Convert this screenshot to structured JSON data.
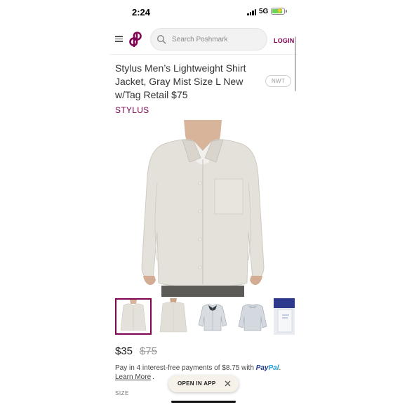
{
  "status_bar": {
    "time": "2:24",
    "network": "5G",
    "battery_level": 0.8,
    "battery_color": "#6cd454"
  },
  "header": {
    "menu_icon": "hamburger-menu-icon",
    "logo_icon": "poshmark-logo-icon",
    "search_placeholder": "Search Poshmark",
    "login_label": "LOGIN",
    "accent_color": "#7f0353"
  },
  "listing": {
    "title": "Stylus Men’s Lightweight Shirt Jacket, Gray Mist Size L New w/Tag Retail $75",
    "condition_badge": "NWT",
    "brand": "STYLUS",
    "price": "$35",
    "original_price": "$75",
    "pay_text": "Pay in 4 interest-free payments of $8.75 with",
    "paypal_part1": "Pay",
    "paypal_part2": "Pal",
    "pay_end": ".",
    "learn_more": "Learn More",
    "learn_more_suffix": ".",
    "size_label": "SIZE"
  },
  "gallery": {
    "main_image": "jacket-front-on-model",
    "thumbnails": [
      {
        "name": "jacket-front-on-model",
        "selected": true
      },
      {
        "name": "jacket-back-on-model",
        "selected": false
      },
      {
        "name": "jacket-flat-front",
        "selected": false
      },
      {
        "name": "jacket-flat-back",
        "selected": false
      },
      {
        "name": "jacket-tag",
        "selected": false
      }
    ]
  },
  "open_in_app": {
    "label": "OPEN IN APP",
    "close_icon": "close-icon"
  }
}
